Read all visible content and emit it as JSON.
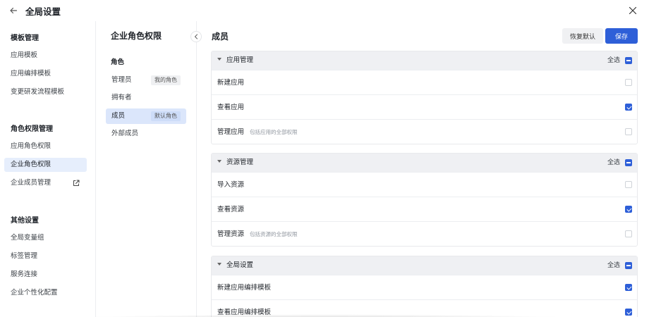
{
  "header": {
    "title": "全局设置",
    "back_icon": "arrow-left-icon",
    "close_icon": "close-icon"
  },
  "sidebar": {
    "groups": [
      {
        "title": "模板管理",
        "items": [
          {
            "label": "应用模板"
          },
          {
            "label": "应用编排模板"
          },
          {
            "label": "变更研发流程模板"
          }
        ]
      },
      {
        "title": "角色权限管理",
        "items": [
          {
            "label": "应用角色权限"
          },
          {
            "label": "企业角色权限",
            "active": true
          },
          {
            "label": "企业成员管理",
            "icon": "external-link-icon"
          }
        ]
      },
      {
        "title": "其他设置",
        "items": [
          {
            "label": "全局变量组"
          },
          {
            "label": "标签管理"
          },
          {
            "label": "服务连接"
          },
          {
            "label": "企业个性化配置"
          }
        ]
      }
    ]
  },
  "roles_panel": {
    "title": "企业角色权限",
    "collapse_icon": "chevron-left-icon",
    "section_label": "角色",
    "roles": [
      {
        "label": "管理员",
        "tag": "我的角色"
      },
      {
        "label": "拥有者",
        "tag": ""
      },
      {
        "label": "成员",
        "tag": "默认角色",
        "active": true
      },
      {
        "label": "外部成员",
        "tag": ""
      }
    ]
  },
  "main": {
    "title": "成员",
    "reset_label": "恢复默认",
    "save_label": "保存",
    "select_all_label": "全选",
    "groups": [
      {
        "name": "应用管理",
        "select_all_state": "partial",
        "rows": [
          {
            "label": "新建应用",
            "hint": "",
            "checked": false
          },
          {
            "label": "查看应用",
            "hint": "",
            "checked": true
          },
          {
            "label": "管理应用",
            "hint": "包括应用的全部权限",
            "checked": false
          }
        ]
      },
      {
        "name": "资源管理",
        "select_all_state": "partial",
        "rows": [
          {
            "label": "导入资源",
            "hint": "",
            "checked": false
          },
          {
            "label": "查看资源",
            "hint": "",
            "checked": true
          },
          {
            "label": "管理资源",
            "hint": "包括资源的全部权限",
            "checked": false
          }
        ]
      },
      {
        "name": "全局设置",
        "select_all_state": "partial",
        "rows": [
          {
            "label": "新建应用编排模板",
            "hint": "",
            "checked": true
          },
          {
            "label": "查看应用编排模板",
            "hint": "",
            "checked": true
          }
        ]
      }
    ]
  },
  "colors": {
    "accent": "#2e5fd8",
    "active_nav_bg": "#e6eefc",
    "group_header_bg": "#eff0f3"
  }
}
